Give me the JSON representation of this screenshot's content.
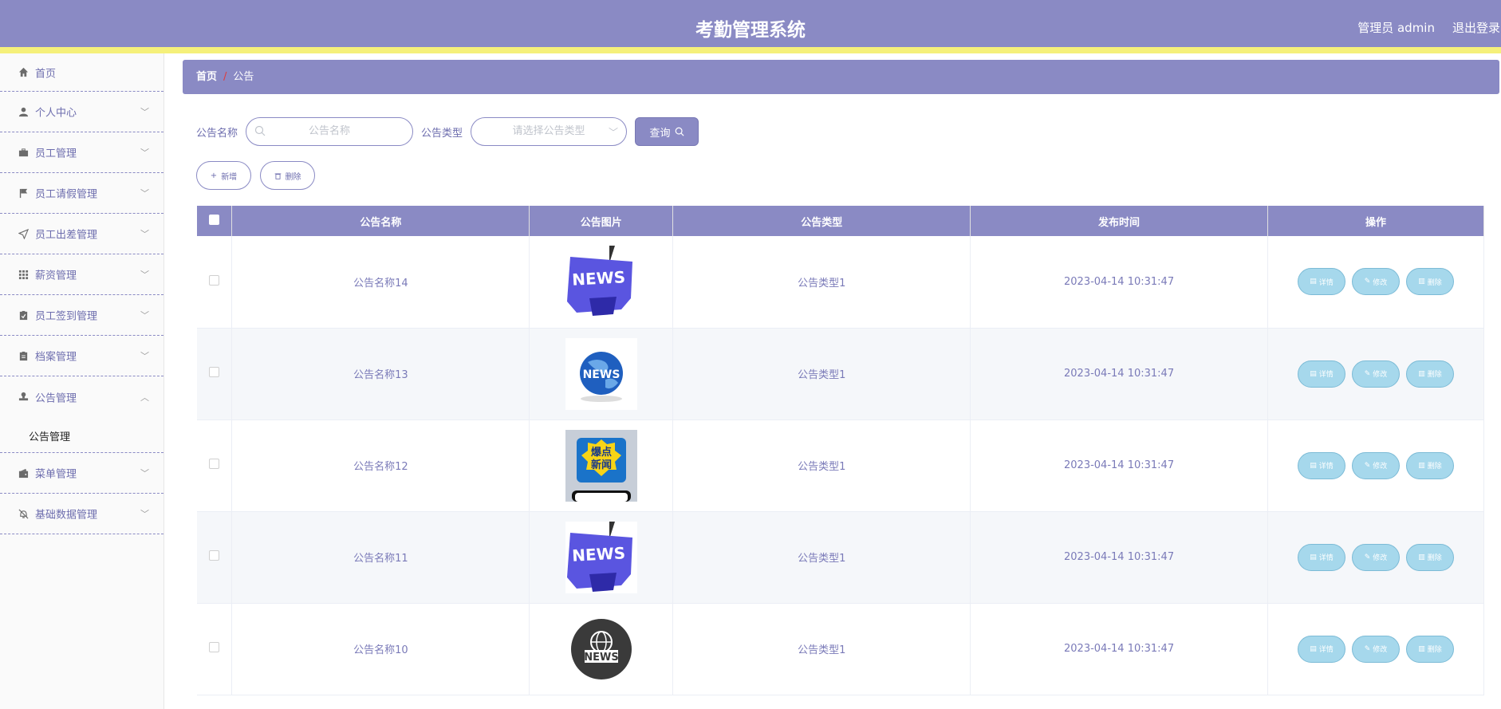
{
  "header": {
    "title": "考勤管理系统",
    "user": "管理员 admin",
    "logout": "退出登录"
  },
  "sidebar": {
    "items": [
      {
        "label": "首页",
        "icon": "home-icon",
        "expanded": null
      },
      {
        "label": "个人中心",
        "icon": "user-icon",
        "expanded": false
      },
      {
        "label": "员工管理",
        "icon": "briefcase-icon",
        "expanded": false
      },
      {
        "label": "员工请假管理",
        "icon": "flag-icon",
        "expanded": false
      },
      {
        "label": "员工出差管理",
        "icon": "send-icon",
        "expanded": false
      },
      {
        "label": "薪资管理",
        "icon": "grid-icon",
        "expanded": false
      },
      {
        "label": "员工签到管理",
        "icon": "clipboard-check-icon",
        "expanded": false
      },
      {
        "label": "档案管理",
        "icon": "clipboard-icon",
        "expanded": false
      },
      {
        "label": "公告管理",
        "icon": "stamp-icon",
        "expanded": true,
        "sub": "公告管理"
      },
      {
        "label": "菜单管理",
        "icon": "wallet-icon",
        "expanded": false
      },
      {
        "label": "基础数据管理",
        "icon": "bell-off-icon",
        "expanded": false
      }
    ]
  },
  "breadcrumb": {
    "home": "首页",
    "separator": "/",
    "current": "公告"
  },
  "search": {
    "name_label": "公告名称",
    "name_placeholder": "公告名称",
    "type_label": "公告类型",
    "type_placeholder": "请选择公告类型",
    "query_button": "查询"
  },
  "actions": {
    "add": "新增",
    "delete": "删除"
  },
  "table": {
    "headers": [
      "公告名称",
      "公告图片",
      "公告类型",
      "发布时间",
      "操作"
    ],
    "rows": [
      {
        "name": "公告名称14",
        "image": "news-key",
        "type": "公告类型1",
        "time": "2023-04-14 10:31:47"
      },
      {
        "name": "公告名称13",
        "image": "news-globe",
        "type": "公告类型1",
        "time": "2023-04-14 10:31:47"
      },
      {
        "name": "公告名称12",
        "image": "hot-news-phone",
        "type": "公告类型1",
        "time": "2023-04-14 10:31:47"
      },
      {
        "name": "公告名称11",
        "image": "news-key",
        "type": "公告类型1",
        "time": "2023-04-14 10:31:47"
      },
      {
        "name": "公告名称10",
        "image": "news-circle",
        "type": "公告类型1",
        "time": "2023-04-14 10:31:47"
      }
    ],
    "op_labels": {
      "detail": "详情",
      "edit": "修改",
      "delete": "删除"
    }
  },
  "images": {
    "hot_news_text_1": "爆点",
    "hot_news_text_2": "新闻"
  },
  "colors": {
    "primary": "#8a8ac4",
    "accent_bar": "#f5f07a",
    "op_button": "#a6d8ec"
  }
}
